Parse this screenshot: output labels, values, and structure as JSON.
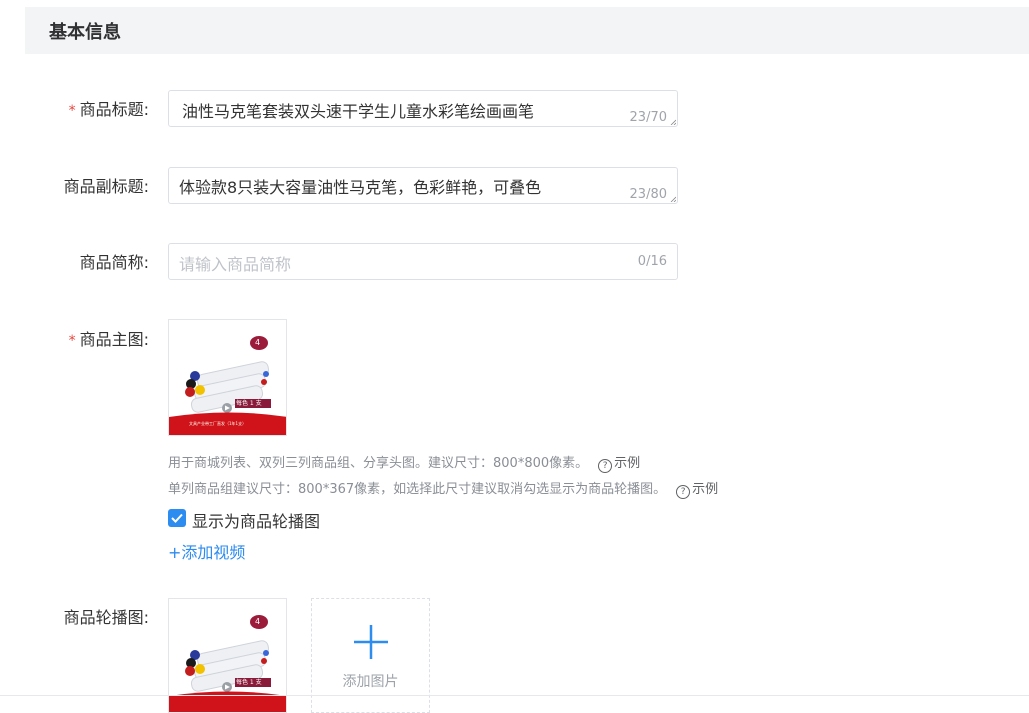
{
  "section": {
    "title": "基本信息"
  },
  "fields": {
    "title": {
      "label": "商品标题:",
      "required_mark": "*",
      "value": "油性马克笔套装双头速干学生儿童水彩笔绘画画笔",
      "counter": "23/70"
    },
    "subtitle": {
      "label": "商品副标题:",
      "value": "体验款8只装大容量油性马克笔，色彩鲜艳，可叠色",
      "counter": "23/80"
    },
    "short_name": {
      "label": "商品简称:",
      "placeholder": "请输入商品简称",
      "counter": "0/16"
    },
    "main_image": {
      "label": "商品主图:",
      "required_mark": "*",
      "help1": "用于商城列表、双列三列商品组、分享头图。建议尺寸：800*800像素。",
      "help2": "单列商品组建议尺寸：800*367像素，如选择此尺寸建议取消勾选显示为商品轮播图。",
      "example_label": "示例",
      "checkbox_label": "显示为商品轮播图",
      "checkbox_checked": true,
      "add_video": "+添加视频"
    },
    "carousel": {
      "label": "商品轮播图:",
      "add_image": "添加图片"
    }
  },
  "product_image": {
    "badge": "4",
    "color_tag": "每色 1 支",
    "banner_text": "文具产业带工厂直发（1年1支）"
  },
  "colors": {
    "accent": "#2d8cf0",
    "required": "#e6453a",
    "banner": "#d0121b",
    "badge": "#9b1b3a"
  }
}
